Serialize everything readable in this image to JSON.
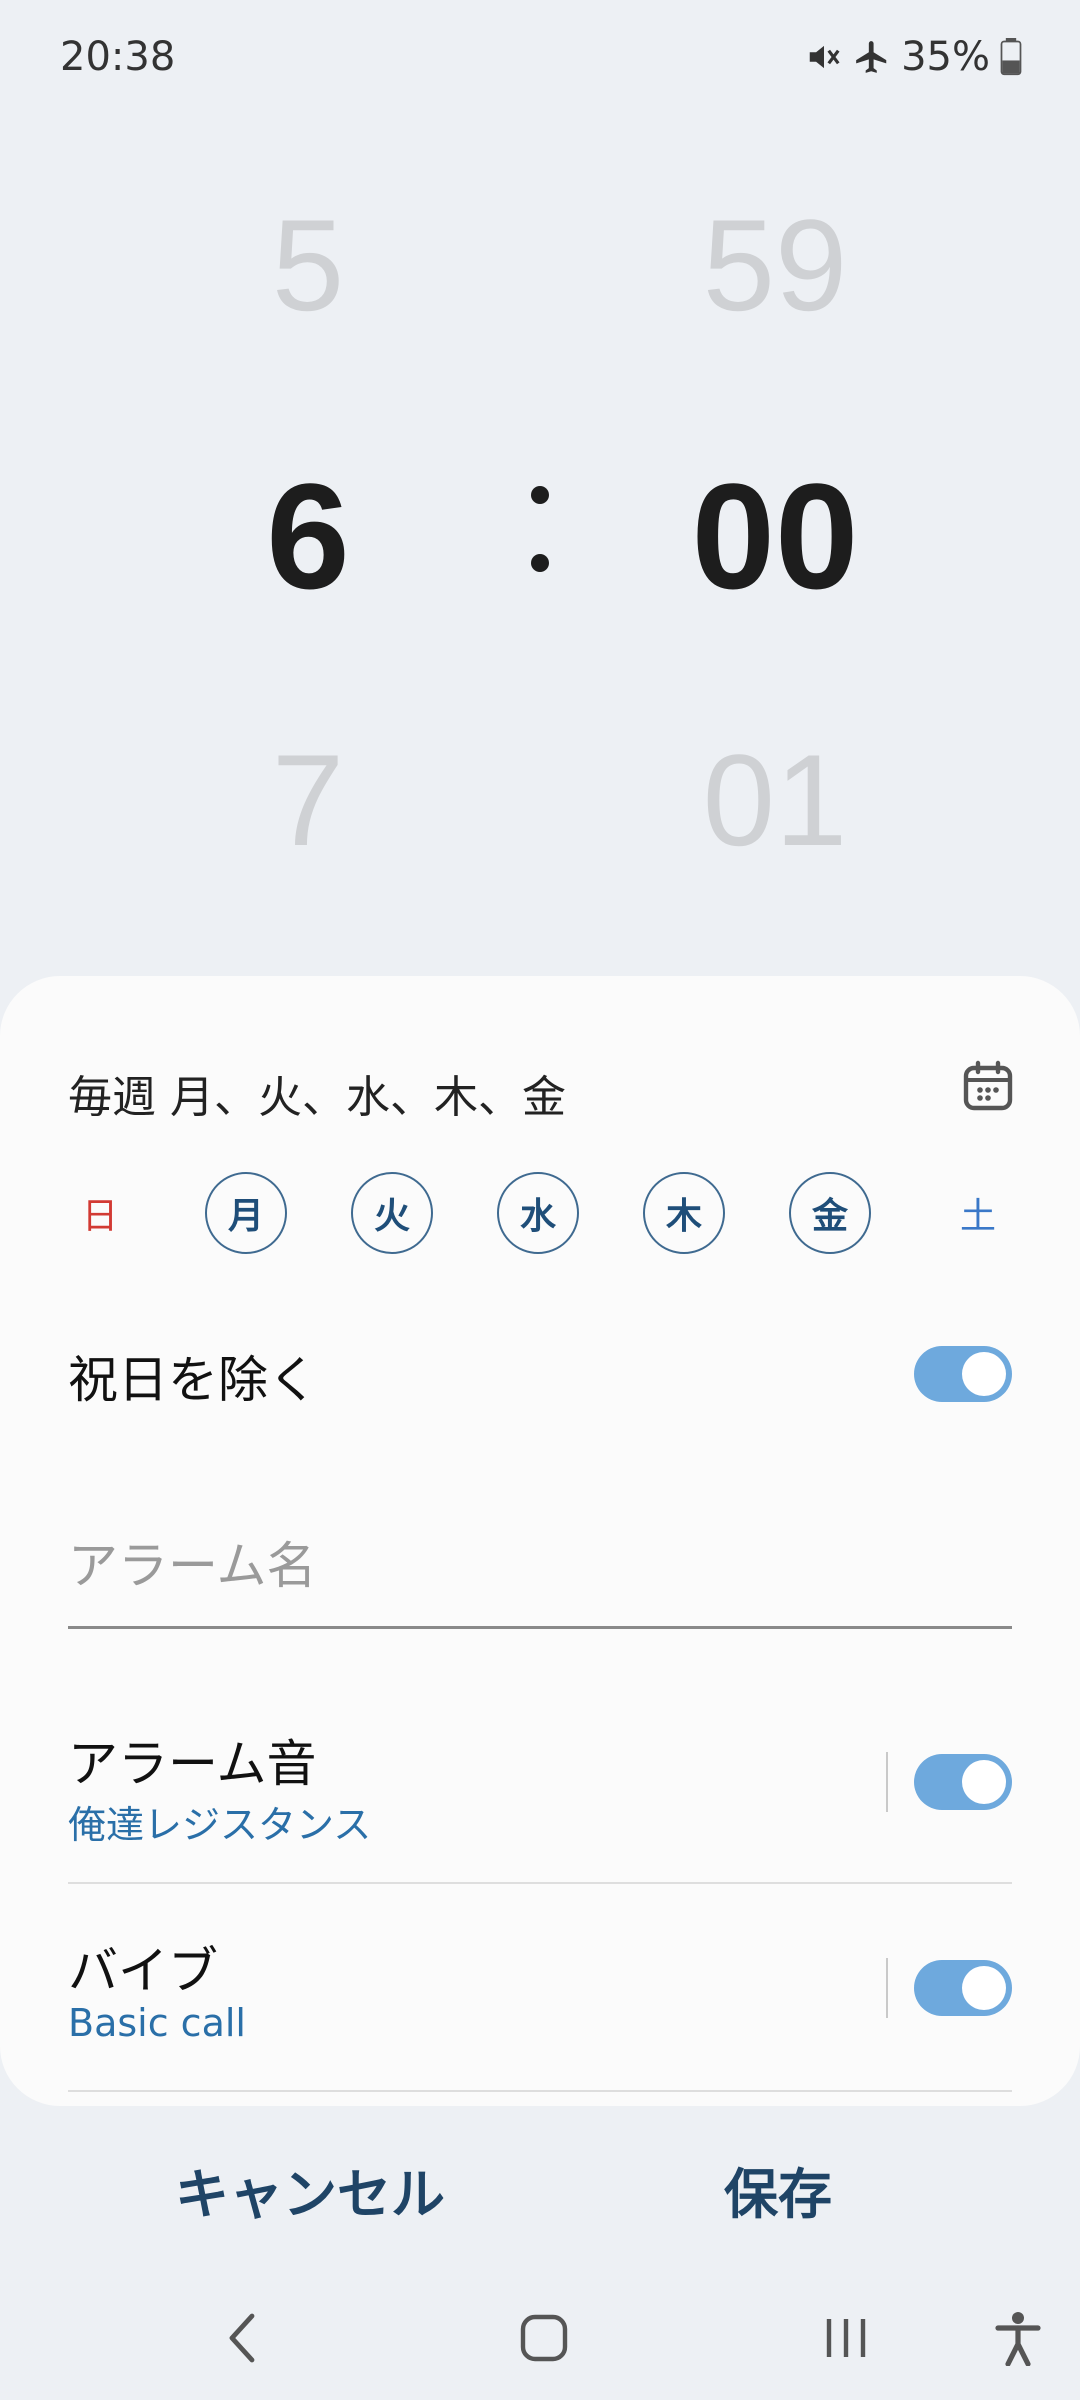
{
  "status_bar": {
    "time": "20:38",
    "battery": "35%",
    "icons": [
      "mute-icon",
      "airplane-icon",
      "battery-icon"
    ]
  },
  "picker": {
    "hour_prev": "5",
    "hour_selected": "6",
    "hour_next": "7",
    "separator": ":",
    "minute_prev": "59",
    "minute_selected": "00",
    "minute_next": "01"
  },
  "repeat": {
    "summary": "毎週 月、火、水、木、金",
    "calendar_icon": "calendar-icon",
    "days": [
      {
        "label": "日",
        "selected": false
      },
      {
        "label": "月",
        "selected": true
      },
      {
        "label": "火",
        "selected": true
      },
      {
        "label": "水",
        "selected": true
      },
      {
        "label": "木",
        "selected": true
      },
      {
        "label": "金",
        "selected": true
      },
      {
        "label": "土",
        "selected": false
      }
    ]
  },
  "exclude_holidays": {
    "label": "祝日を除く",
    "enabled": true
  },
  "alarm_name": {
    "value": "",
    "placeholder": "アラーム名"
  },
  "alarm_sound": {
    "label": "アラーム音",
    "value": "俺達レジスタンス",
    "enabled": true
  },
  "vibration": {
    "label": "バイブ",
    "value": "Basic call",
    "enabled": true
  },
  "actions": {
    "cancel": "キャンセル",
    "save": "保存"
  },
  "nav": {
    "icons": [
      "back-icon",
      "home-icon",
      "recents-icon",
      "accessibility-icon"
    ]
  },
  "colors": {
    "accent": "#6ea9dd",
    "sunday": "#d23a33",
    "saturday": "#3a78c8",
    "selected_day_text": "#1f4e79",
    "subtext": "#2a6fa8"
  }
}
